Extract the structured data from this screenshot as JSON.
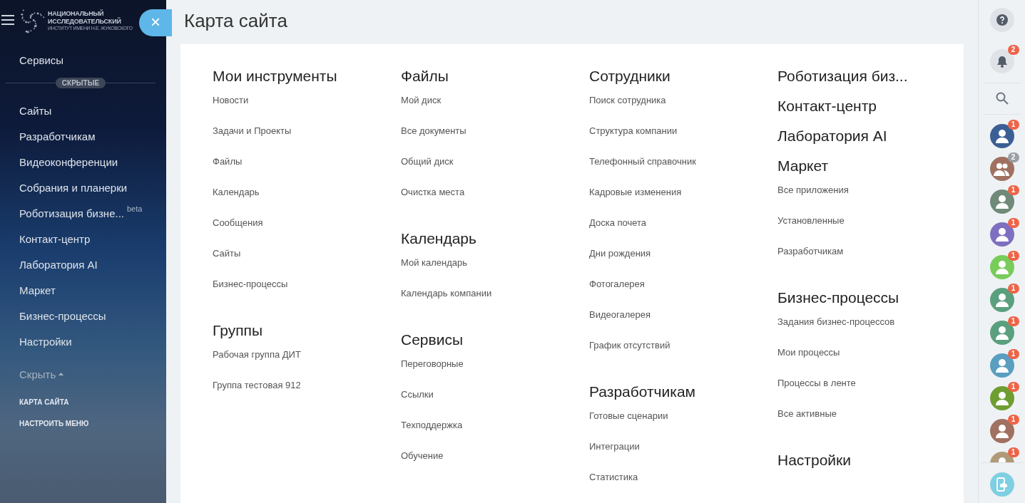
{
  "logo": {
    "line1": "НАЦИОНАЛЬНЫЙ",
    "line2": "ИССЛЕДОВАТЕЛЬСКИЙ",
    "line3": "ИНСТИТУТ ИМЕНИ Н.Е. ЖУКОВСКОГО"
  },
  "close_button": {
    "label": "×"
  },
  "sidebar": {
    "top_item": "Сервисы",
    "divider_label": "СКРЫТЫЕ",
    "items": [
      {
        "label": "Сайты",
        "kind": "link"
      },
      {
        "label": "Разработчикам",
        "kind": "link"
      },
      {
        "label": "Видеоконференции",
        "kind": "link"
      },
      {
        "label": "Собрания и планерки",
        "kind": "link"
      },
      {
        "label": "Роботизация бизне...",
        "kind": "link",
        "badge": "beta"
      },
      {
        "label": "Контакт-центр",
        "kind": "link"
      },
      {
        "label": "Лаборатория AI",
        "kind": "link"
      },
      {
        "label": "Маркет",
        "kind": "link"
      },
      {
        "label": "Бизнес-процессы",
        "kind": "link"
      },
      {
        "label": "Настройки",
        "kind": "link"
      },
      {
        "label": "Скрыть",
        "kind": "toggle"
      }
    ],
    "footer_links": [
      "КАРТА САЙТА",
      "НАСТРОИТЬ МЕНЮ"
    ]
  },
  "page": {
    "title": "Карта сайта",
    "columns": [
      [
        {
          "title": "Мои инструменты",
          "links": [
            "Новости",
            "Задачи и Проекты",
            "Файлы",
            "Календарь",
            "Сообщения",
            "Сайты",
            "Бизнес-процессы"
          ]
        },
        {
          "title": "Группы",
          "links": [
            "Рабочая группа ДИТ",
            "Группа тестовая 912"
          ]
        }
      ],
      [
        {
          "title": "Файлы",
          "links": [
            "Мой диск",
            "Все документы",
            "Общий диск",
            "Очистка места"
          ]
        },
        {
          "title": "Календарь",
          "links": [
            "Мой календарь",
            "Календарь компании"
          ]
        },
        {
          "title": "Сервисы",
          "links": [
            "Переговорные",
            "Ссылки",
            "Техподдержка",
            "Обучение"
          ]
        }
      ],
      [
        {
          "title": "Сотрудники",
          "links": [
            "Поиск сотрудника",
            "Структура компании",
            "Телефонный справочник",
            "Кадровые изменения",
            "Доска почета",
            "Дни рождения",
            "Фотогалерея",
            "Видеогалерея",
            "График отсутствий"
          ]
        },
        {
          "title": "Разработчикам",
          "links": [
            "Готовые сценарии",
            "Интеграции",
            "Статистика"
          ]
        }
      ],
      [
        {
          "title": "Роботизация биз..."
        },
        {
          "title": "Контакт-центр"
        },
        {
          "title": "Лаборатория AI"
        },
        {
          "title": "Маркет",
          "links": [
            "Все приложения",
            "Установленные",
            "Разработчикам"
          ]
        },
        {
          "title": "Бизнес-процессы",
          "links": [
            "Задания бизнес-процессов",
            "Мои процессы",
            "Процессы в ленте",
            "Все активные"
          ]
        },
        {
          "title": "Настройки"
        }
      ]
    ]
  },
  "right_bar": {
    "notification_count": "2",
    "chats": [
      {
        "kind": "user",
        "color": "#3a5f94",
        "count": "1",
        "muted": false
      },
      {
        "kind": "group",
        "color": "#a07060",
        "count": "2",
        "muted": true
      },
      {
        "kind": "user",
        "color": "#6f8a78",
        "count": "1",
        "muted": false
      },
      {
        "kind": "user",
        "color": "#7f6fc0",
        "count": "1",
        "muted": false
      },
      {
        "kind": "user",
        "color": "#78cc5a",
        "count": "1",
        "muted": false
      },
      {
        "kind": "user",
        "color": "#5aa07e",
        "count": "1",
        "muted": false
      },
      {
        "kind": "user",
        "color": "#5aa07e",
        "count": "1",
        "muted": false
      },
      {
        "kind": "user",
        "color": "#5a9ec0",
        "count": "1",
        "muted": false
      },
      {
        "kind": "user",
        "color": "#6e9e32",
        "count": "1",
        "muted": false
      },
      {
        "kind": "user",
        "color": "#a07060",
        "count": "1",
        "muted": false
      },
      {
        "kind": "user",
        "color": "#b09a78",
        "count": "1",
        "muted": false
      }
    ]
  }
}
